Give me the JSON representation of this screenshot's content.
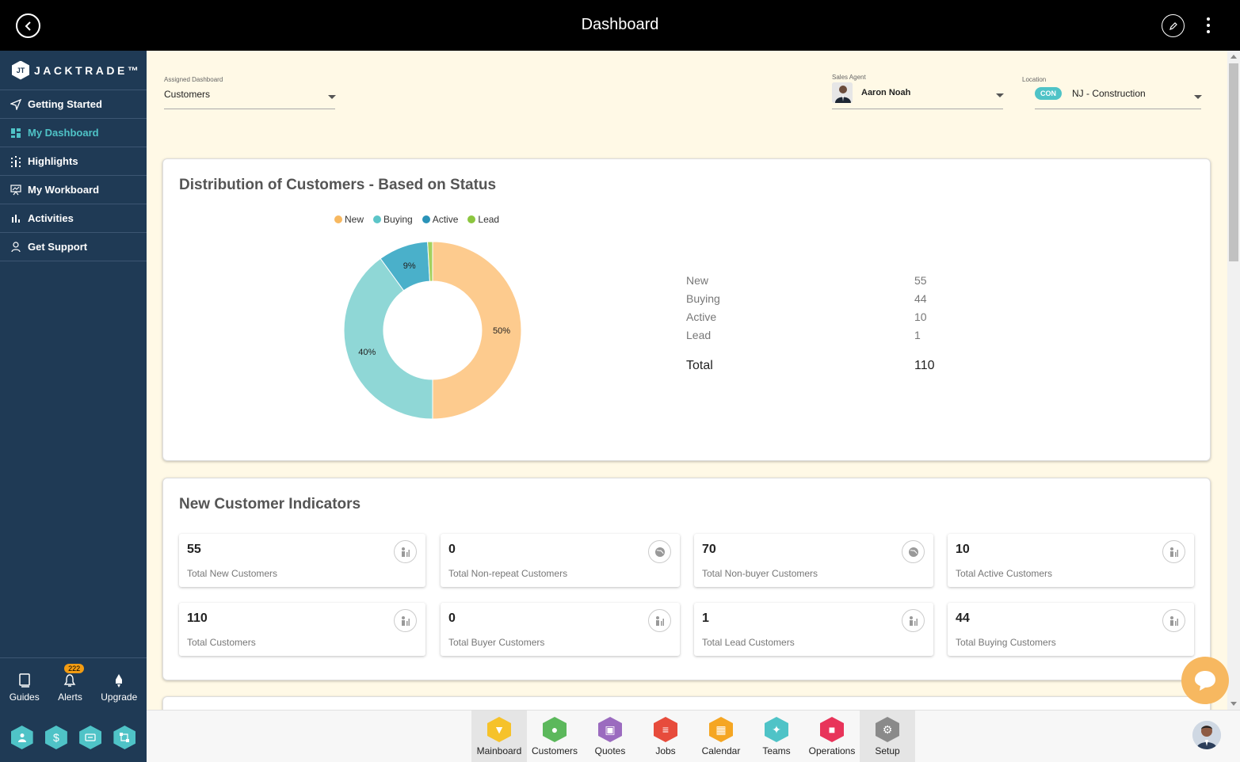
{
  "header": {
    "title": "Dashboard"
  },
  "brand": {
    "name": "JACKTRADE™",
    "mark": "JT"
  },
  "sidebar": {
    "items": [
      {
        "label": "Getting Started",
        "icon": "send-icon"
      },
      {
        "label": "My Dashboard",
        "icon": "dashboard-icon",
        "active": true
      },
      {
        "label": "Highlights",
        "icon": "highlights-icon"
      },
      {
        "label": "My Workboard",
        "icon": "workboard-icon"
      },
      {
        "label": "Activities",
        "icon": "bar-chart-icon"
      },
      {
        "label": "Get Support",
        "icon": "support-icon"
      }
    ],
    "utilities": [
      {
        "label": "Guides",
        "icon": "book-icon"
      },
      {
        "label": "Alerts",
        "icon": "bell-icon",
        "badge": "222"
      },
      {
        "label": "Upgrade",
        "icon": "rocket-icon"
      }
    ]
  },
  "filters": {
    "assigned_dashboard": {
      "label": "Assigned Dashboard",
      "value": "Customers"
    },
    "sales_agent": {
      "label": "Sales Agent",
      "value": "Aaron Noah"
    },
    "location": {
      "label": "Location",
      "badge": "CON",
      "value": "NJ - Construction"
    }
  },
  "distribution": {
    "title": "Distribution of Customers - Based on Status",
    "rows": [
      {
        "name": "New",
        "value": "55"
      },
      {
        "name": "Buying",
        "value": "44"
      },
      {
        "name": "Active",
        "value": "10"
      },
      {
        "name": "Lead",
        "value": "1"
      }
    ],
    "total_label": "Total",
    "total_value": "110"
  },
  "chart_data": {
    "type": "pie",
    "title": "",
    "categories": [
      "New",
      "Buying",
      "Active",
      "Lead"
    ],
    "values": [
      55,
      44,
      10,
      1
    ],
    "data_labels": [
      "50%",
      "40%",
      "9%",
      ""
    ],
    "colors": [
      "#fdcb8e",
      "#8fd7d6",
      "#4ab0ca",
      "#a4d15e"
    ],
    "legend": "top",
    "donut": true
  },
  "indicators": {
    "title": "New Customer Indicators",
    "items": [
      {
        "value": "55",
        "label": "Total New Customers",
        "icon": "people-chart-icon"
      },
      {
        "value": "0",
        "label": "Total Non-repeat Customers",
        "icon": "globe-icon"
      },
      {
        "value": "70",
        "label": "Total Non-buyer Customers",
        "icon": "globe-icon"
      },
      {
        "value": "10",
        "label": "Total Active Customers",
        "icon": "people-chart-icon"
      },
      {
        "value": "110",
        "label": "Total Customers",
        "icon": "people-chart-icon"
      },
      {
        "value": "0",
        "label": "Total Buyer Customers",
        "icon": "people-chart-icon"
      },
      {
        "value": "1",
        "label": "Total Lead Customers",
        "icon": "people-chart-icon"
      },
      {
        "value": "44",
        "label": "Total Buying Customers",
        "icon": "people-chart-icon"
      }
    ]
  },
  "bottom_nav": [
    {
      "label": "Mainboard",
      "color": "#f6c22a",
      "selected": true
    },
    {
      "label": "Customers",
      "color": "#5cb85c"
    },
    {
      "label": "Quotes",
      "color": "#9b6bbf"
    },
    {
      "label": "Jobs",
      "color": "#e74c3c"
    },
    {
      "label": "Calendar",
      "color": "#f5a623"
    },
    {
      "label": "Teams",
      "color": "#4fc3c7"
    },
    {
      "label": "Operations",
      "color": "#e8345a"
    },
    {
      "label": "Setup",
      "color": "#8a8a8a",
      "selected": true
    }
  ],
  "colors": {
    "accent": "#4fc3c7",
    "sidebar": "#1f3a55",
    "main_bg": "#fff9e6"
  }
}
